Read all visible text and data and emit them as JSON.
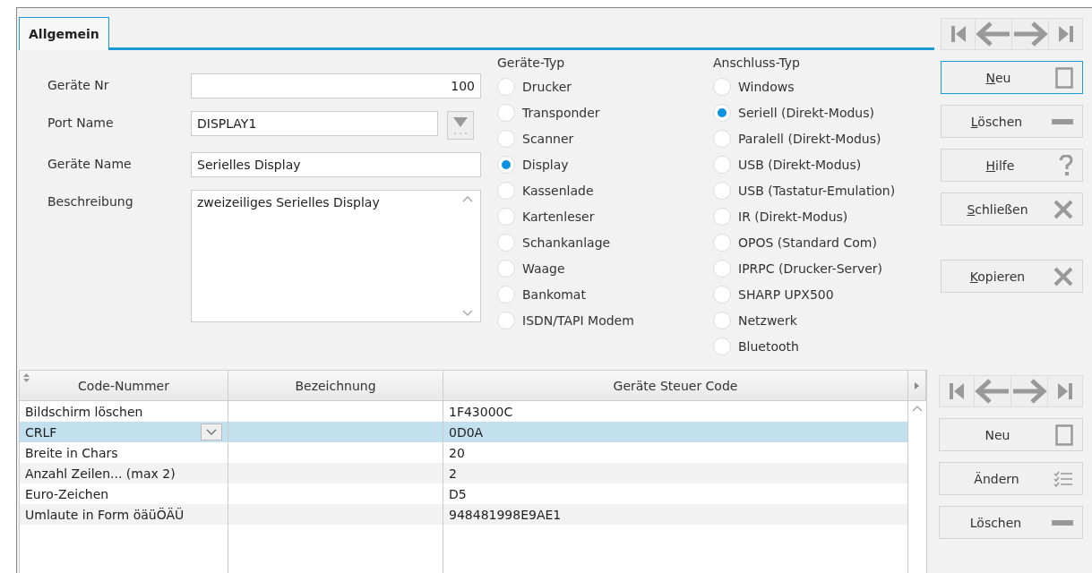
{
  "tabs": [
    {
      "label": "Allgemein",
      "selected": true
    }
  ],
  "fields": [
    {
      "label": "Geräte Nr",
      "value": "100",
      "kind": "number"
    },
    {
      "label": "Port Name",
      "value": "DISPLAY1",
      "kind": "dropdown"
    },
    {
      "label": "Geräte Name",
      "value": "Serielles Display",
      "kind": "text"
    },
    {
      "label": "Beschreibung",
      "value": "zweizeiliges Serielles Display",
      "kind": "textarea"
    }
  ],
  "radio_groups": [
    {
      "title": "Geräte-Typ",
      "options": [
        {
          "label": "Drucker",
          "selected": false
        },
        {
          "label": "Transponder",
          "selected": false
        },
        {
          "label": "Scanner",
          "selected": false
        },
        {
          "label": "Display",
          "selected": true
        },
        {
          "label": "Kassenlade",
          "selected": false
        },
        {
          "label": "Kartenleser",
          "selected": false
        },
        {
          "label": "Schankanlage",
          "selected": false
        },
        {
          "label": "Waage",
          "selected": false
        },
        {
          "label": "Bankomat",
          "selected": false
        },
        {
          "label": "ISDN/TAPI Modem",
          "selected": false
        }
      ]
    },
    {
      "title": "Anschluss-Typ",
      "options": [
        {
          "label": "Windows",
          "selected": false
        },
        {
          "label": "Seriell (Direkt-Modus)",
          "selected": true
        },
        {
          "label": "Paralell (Direkt-Modus)",
          "selected": false
        },
        {
          "label": "USB (Direkt-Modus)",
          "selected": false
        },
        {
          "label": "USB (Tastatur-Emulation)",
          "selected": false
        },
        {
          "label": "IR (Direkt-Modus)",
          "selected": false
        },
        {
          "label": "OPOS (Standard Com)",
          "selected": false
        },
        {
          "label": "IPRPC (Drucker-Server)",
          "selected": false
        },
        {
          "label": "SHARP UPX500",
          "selected": false
        },
        {
          "label": "Netzwerk",
          "selected": false
        },
        {
          "label": "Bluetooth",
          "selected": false
        }
      ]
    }
  ],
  "side_buttons": [
    {
      "label": "Neu",
      "kind": "new",
      "focused": true,
      "underline_first": true
    },
    {
      "label": "Löschen",
      "kind": "delete",
      "focused": false,
      "underline_first": true
    },
    {
      "label": "Hilfe",
      "kind": "help",
      "focused": false,
      "underline_first": true
    },
    {
      "label": "Schließen",
      "kind": "close",
      "focused": false,
      "underline_first": true
    },
    {
      "label": "Kopieren",
      "kind": "close",
      "focused": false,
      "underline_first": true,
      "spaced": true
    }
  ],
  "table": {
    "columns": [
      "Code-Nummer",
      "Bezeichnung",
      "Geräte Steuer Code"
    ],
    "rows": [
      {
        "cells": [
          "Bildschirm löschen",
          "",
          "1F43000C"
        ],
        "selected": false
      },
      {
        "cells": [
          "CRLF",
          "",
          "0D0A"
        ],
        "selected": true
      },
      {
        "cells": [
          "Breite in Chars",
          "",
          "20"
        ],
        "selected": false
      },
      {
        "cells": [
          "Anzahl Zeilen... (max 2)",
          "",
          "2"
        ],
        "selected": false
      },
      {
        "cells": [
          "Euro-Zeichen",
          "",
          "D5"
        ],
        "selected": false
      },
      {
        "cells": [
          "Umlaute in Form öäüÖÄÜ",
          "",
          "948481998E9AE1"
        ],
        "selected": false
      }
    ]
  },
  "table_buttons": [
    {
      "label": "Neu",
      "kind": "new",
      "focused": false,
      "underline_first": false
    },
    {
      "label": "Ändern",
      "kind": "edit",
      "focused": false,
      "underline_first": false
    },
    {
      "label": "Löschen",
      "kind": "delete",
      "focused": false,
      "underline_first": false
    }
  ]
}
